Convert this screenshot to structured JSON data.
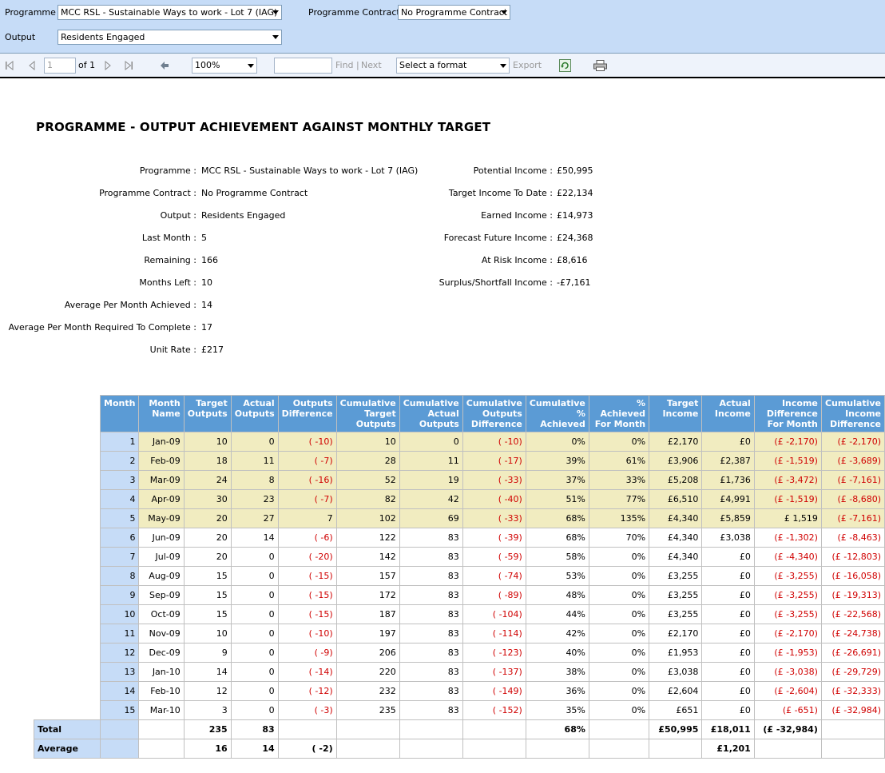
{
  "params": {
    "programme_label": "Programme",
    "programme_value": "MCC RSL - Sustainable Ways to work - Lot 7 (IAG)",
    "contract_label": "Programme Contract",
    "contract_value": "No Programme Contract",
    "output_label": "Output",
    "output_value": "Residents Engaged"
  },
  "toolbar": {
    "page_value": "1",
    "page_of": "of 1",
    "zoom": "100%",
    "find_label": "Find",
    "separator": "|",
    "next_label": "Next",
    "format_select": "Select a format",
    "export_label": "Export"
  },
  "report": {
    "title": "PROGRAMME - OUTPUT ACHIEVEMENT AGAINST MONTHLY TARGET",
    "left_fields": [
      {
        "label": "Programme :",
        "value": "MCC RSL - Sustainable Ways to work - Lot 7 (IAG)"
      },
      {
        "label": "Programme Contract :",
        "value": "No Programme Contract"
      },
      {
        "label": "Output :",
        "value": "Residents Engaged"
      },
      {
        "label": "Last Month :",
        "value": "5"
      },
      {
        "label": "Remaining :",
        "value": "166"
      },
      {
        "label": "Months Left :",
        "value": "10"
      },
      {
        "label": "Average Per Month Achieved :",
        "value": "14"
      },
      {
        "label": "Average Per Month Required To Complete :",
        "value": "17"
      },
      {
        "label": "Unit Rate :",
        "value": "£217"
      }
    ],
    "right_fields": [
      {
        "label": "Potential Income :",
        "value": "£50,995"
      },
      {
        "label": "Target Income To Date :",
        "value": "£22,134"
      },
      {
        "label": "Earned Income :",
        "value": "£14,973"
      },
      {
        "label": "Forecast Future Income :",
        "value": "£24,368"
      },
      {
        "label": "At Risk Income :",
        "value": "£8,616"
      },
      {
        "label": "Surplus/Shortfall Income :",
        "value": "-£7,161"
      }
    ],
    "table": {
      "headers": [
        "Month",
        "Month Name",
        "Target Outputs",
        "Actual Outputs",
        "Outputs Difference",
        "Cumulative Target Outputs",
        "Cumulative Actual Outputs",
        "Cumulative Outputs Difference",
        "Cumulative % Achieved",
        "% Achieved For Month",
        "Target Income",
        "Actual Income",
        "Income Difference For Month",
        "Cumulative Income Difference"
      ],
      "rows": [
        [
          "1",
          "Jan-09",
          "10",
          "0",
          "( -10)",
          "10",
          "0",
          "( -10)",
          "0%",
          "0%",
          "£2,170",
          "£0",
          "(£ -2,170)",
          "(£ -2,170)"
        ],
        [
          "2",
          "Feb-09",
          "18",
          "11",
          "( -7)",
          "28",
          "11",
          "( -17)",
          "39%",
          "61%",
          "£3,906",
          "£2,387",
          "(£ -1,519)",
          "(£ -3,689)"
        ],
        [
          "3",
          "Mar-09",
          "24",
          "8",
          "( -16)",
          "52",
          "19",
          "( -33)",
          "37%",
          "33%",
          "£5,208",
          "£1,736",
          "(£ -3,472)",
          "(£ -7,161)"
        ],
        [
          "4",
          "Apr-09",
          "30",
          "23",
          "( -7)",
          "82",
          "42",
          "( -40)",
          "51%",
          "77%",
          "£6,510",
          "£4,991",
          "(£ -1,519)",
          "(£ -8,680)"
        ],
        [
          "5",
          "May-09",
          "20",
          "27",
          "7",
          "102",
          "69",
          "( -33)",
          "68%",
          "135%",
          "£4,340",
          "£5,859",
          "£ 1,519",
          "(£ -7,161)"
        ],
        [
          "6",
          "Jun-09",
          "20",
          "14",
          "( -6)",
          "122",
          "83",
          "( -39)",
          "68%",
          "70%",
          "£4,340",
          "£3,038",
          "(£ -1,302)",
          "(£ -8,463)"
        ],
        [
          "7",
          "Jul-09",
          "20",
          "0",
          "( -20)",
          "142",
          "83",
          "( -59)",
          "58%",
          "0%",
          "£4,340",
          "£0",
          "(£ -4,340)",
          "(£ -12,803)"
        ],
        [
          "8",
          "Aug-09",
          "15",
          "0",
          "( -15)",
          "157",
          "83",
          "( -74)",
          "53%",
          "0%",
          "£3,255",
          "£0",
          "(£ -3,255)",
          "(£ -16,058)"
        ],
        [
          "9",
          "Sep-09",
          "15",
          "0",
          "( -15)",
          "172",
          "83",
          "( -89)",
          "48%",
          "0%",
          "£3,255",
          "£0",
          "(£ -3,255)",
          "(£ -19,313)"
        ],
        [
          "10",
          "Oct-09",
          "15",
          "0",
          "( -15)",
          "187",
          "83",
          "( -104)",
          "44%",
          "0%",
          "£3,255",
          "£0",
          "(£ -3,255)",
          "(£ -22,568)"
        ],
        [
          "11",
          "Nov-09",
          "10",
          "0",
          "( -10)",
          "197",
          "83",
          "( -114)",
          "42%",
          "0%",
          "£2,170",
          "£0",
          "(£ -2,170)",
          "(£ -24,738)"
        ],
        [
          "12",
          "Dec-09",
          "9",
          "0",
          "( -9)",
          "206",
          "83",
          "( -123)",
          "40%",
          "0%",
          "£1,953",
          "£0",
          "(£ -1,953)",
          "(£ -26,691)"
        ],
        [
          "13",
          "Jan-10",
          "14",
          "0",
          "( -14)",
          "220",
          "83",
          "( -137)",
          "38%",
          "0%",
          "£3,038",
          "£0",
          "(£ -3,038)",
          "(£ -29,729)"
        ],
        [
          "14",
          "Feb-10",
          "12",
          "0",
          "( -12)",
          "232",
          "83",
          "( -149)",
          "36%",
          "0%",
          "£2,604",
          "£0",
          "(£ -2,604)",
          "(£ -32,333)"
        ],
        [
          "15",
          "Mar-10",
          "3",
          "0",
          "( -3)",
          "235",
          "83",
          "( -152)",
          "35%",
          "0%",
          "£651",
          "£0",
          "(£ -651)",
          "(£ -32,984)"
        ]
      ],
      "highlighted_months": 5,
      "total": {
        "label": "Total",
        "cells": [
          "",
          "",
          "235",
          "83",
          "",
          "",
          "",
          "",
          "68%",
          "",
          "£50,995",
          "£18,011",
          "(£ -32,984)",
          ""
        ]
      },
      "average": {
        "label": "Average",
        "cells": [
          "",
          "",
          "16",
          "14",
          "( -2)",
          "",
          "",
          "",
          "",
          "",
          "",
          "£1,201",
          "",
          ""
        ]
      }
    }
  },
  "colors": {
    "param_bg": "#c6dcf7",
    "header_bg": "#5b9bd5",
    "highlight_row": "#f1ecc0",
    "negative_text": "#d00000"
  }
}
